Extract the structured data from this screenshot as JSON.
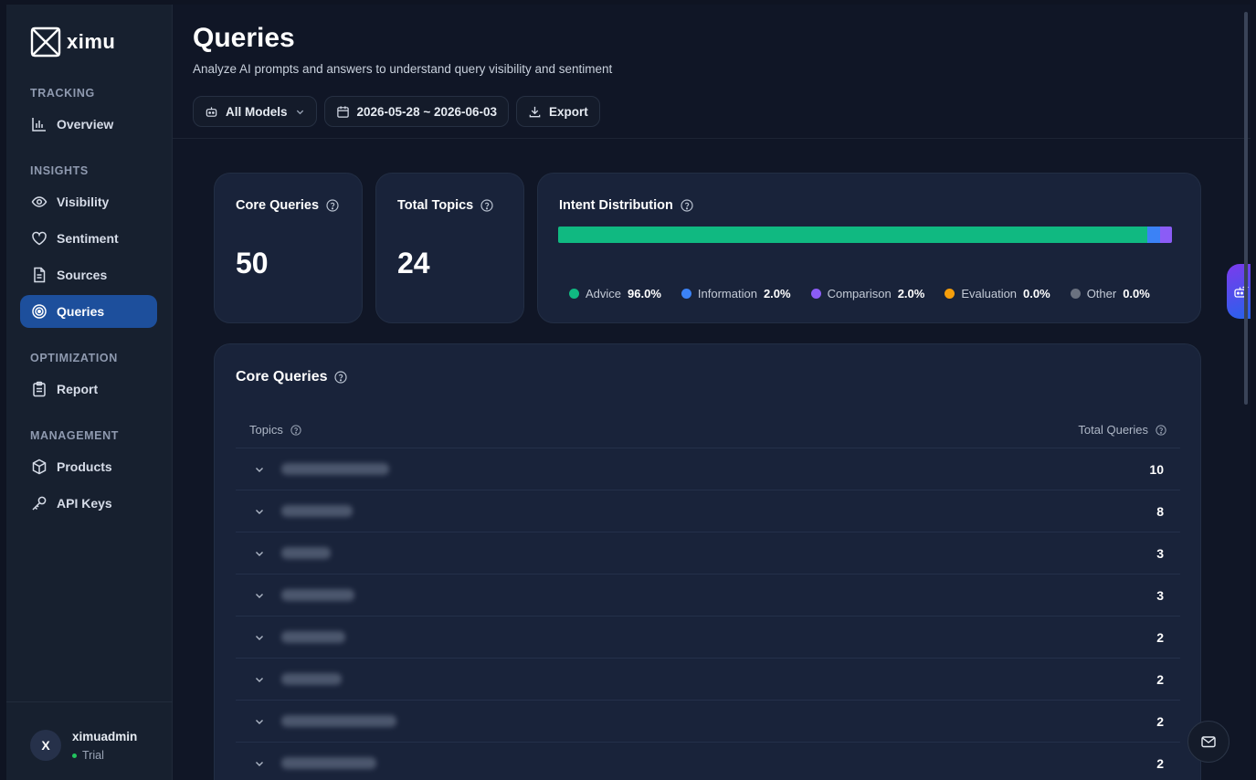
{
  "brand": {
    "name": "ximu"
  },
  "sidebar": {
    "sections": [
      {
        "title": "TRACKING"
      },
      {
        "title": "INSIGHTS"
      },
      {
        "title": "OPTIMIZATION"
      },
      {
        "title": "MANAGEMENT"
      }
    ],
    "items": [
      {
        "label": "Overview",
        "icon": "bar-chart-icon"
      },
      {
        "label": "Visibility",
        "icon": "eye-icon"
      },
      {
        "label": "Sentiment",
        "icon": "heart-icon"
      },
      {
        "label": "Sources",
        "icon": "document-icon"
      },
      {
        "label": "Queries",
        "icon": "target-icon",
        "active": true
      },
      {
        "label": "Report",
        "icon": "clipboard-icon"
      },
      {
        "label": "Products",
        "icon": "box-icon"
      },
      {
        "label": "API Keys",
        "icon": "key-icon"
      }
    ],
    "user": {
      "initial": "X",
      "name": "ximuadmin",
      "plan": "Trial"
    }
  },
  "header": {
    "title": "Queries",
    "subtitle": "Analyze AI prompts and answers to understand query visibility and sentiment",
    "model_select": "All Models",
    "date_range": "2026-05-28 ~ 2026-06-03",
    "export_label": "Export"
  },
  "stats": {
    "core_queries": {
      "label": "Core Queries",
      "value": "50"
    },
    "total_topics": {
      "label": "Total Topics",
      "value": "24"
    }
  },
  "intent": {
    "title": "Intent Distribution",
    "items": [
      {
        "label": "Advice",
        "value": "96.0%",
        "fraction": 0.96,
        "color": "#10b981"
      },
      {
        "label": "Information",
        "value": "2.0%",
        "fraction": 0.02,
        "color": "#3b82f6"
      },
      {
        "label": "Comparison",
        "value": "2.0%",
        "fraction": 0.02,
        "color": "#8b5cf6"
      },
      {
        "label": "Evaluation",
        "value": "0.0%",
        "fraction": 0.0,
        "color": "#f59e0b"
      },
      {
        "label": "Other",
        "value": "0.0%",
        "fraction": 0.0,
        "color": "#6b7280"
      }
    ]
  },
  "core_table": {
    "title": "Core Queries",
    "col_topics": "Topics",
    "col_total": "Total Queries",
    "rows": [
      {
        "count": "10"
      },
      {
        "count": "8"
      },
      {
        "count": "3"
      },
      {
        "count": "3"
      },
      {
        "count": "2"
      },
      {
        "count": "2"
      },
      {
        "count": "2"
      },
      {
        "count": "2"
      }
    ]
  }
}
